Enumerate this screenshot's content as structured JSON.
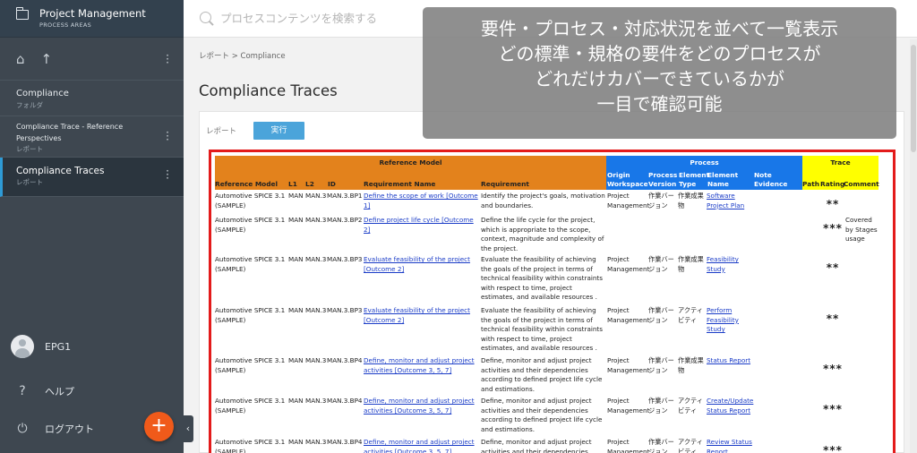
{
  "sidebar": {
    "header_title": "Project Management",
    "header_sub": "PROCESS AREAS",
    "items": [
      {
        "title": "Compliance",
        "sub": "フォルダ"
      },
      {
        "title": "Compliance Trace - Reference Perspectives",
        "sub": "レポート"
      },
      {
        "title": "Compliance Traces",
        "sub": "レポート"
      }
    ],
    "user": "EPG1",
    "help": "ヘルプ",
    "logout": "ログアウト",
    "fab": "+",
    "collapse": "‹",
    "home_icon": "⌂",
    "up_icon": "↑"
  },
  "search": {
    "placeholder": "プロセスコンテンツを検索する"
  },
  "breadcrumb": "レポート > Compliance",
  "page_title": "Compliance Traces",
  "report_label": "レポート",
  "run_button": "実行",
  "overlay": [
    "要件・プロセス・対応状況を並べて一覧表示",
    "どの標準・規格の要件をどのプロセスが",
    "どれだけカバーできているかが",
    "一目で確認可能"
  ],
  "table": {
    "group_headers": {
      "reference": "Reference Model",
      "process": "Process",
      "trace": "Trace"
    },
    "columns": {
      "ref_model": "Reference Model",
      "l1": "L1",
      "l2": "L2",
      "id": "ID",
      "req_name": "Requirement Name",
      "req": "Requirement",
      "origin": "Origin Workspace",
      "pver": "Process Version",
      "etype": "Element Type",
      "ename": "Element Name",
      "note": "Note Evidence",
      "path": "Path",
      "rating": "Rating",
      "comment": "Comment"
    },
    "rows": [
      {
        "ref": "Automotive SPICE 3.1 (SAMPLE)",
        "l1": "MAN",
        "l2": "MAN.3",
        "id": "MAN.3.BP1",
        "rname": "Define the scope of work [Outcome 1]",
        "req": "Identify the project's goals, motivation and boundaries.",
        "origin": "Project Management",
        "pver": "作業バージョン",
        "etype": "作業成果物",
        "ename": "Software Project Plan",
        "rating": "**",
        "comment": ""
      },
      {
        "ref": "Automotive SPICE 3.1 (SAMPLE)",
        "l1": "MAN",
        "l2": "MAN.3",
        "id": "MAN.3.BP2",
        "rname": "Define project life cycle [Outcome 2]",
        "req": "Define the life cycle for the project, which is appropriate to the scope, context, magnitude and complexity of the project.",
        "origin": "",
        "pver": "",
        "etype": "",
        "ename": "",
        "rating": "***",
        "comment": "Covered by Stages usage"
      },
      {
        "ref": "Automotive SPICE 3.1 (SAMPLE)",
        "l1": "MAN",
        "l2": "MAN.3",
        "id": "MAN.3.BP3",
        "rname": "Evaluate feasibility of the project [Outcome 2]",
        "req": "Evaluate the feasibility of achieving the goals of the project in terms of technical feasibility within constraints with respect to time, project estimates, and available resources .",
        "origin": "Project Management",
        "pver": "作業バージョン",
        "etype": "作業成果物",
        "ename": "Feasibility Study",
        "rating": "**",
        "comment": ""
      },
      {
        "ref": "Automotive SPICE 3.1 (SAMPLE)",
        "l1": "MAN",
        "l2": "MAN.3",
        "id": "MAN.3.BP3",
        "rname": "Evaluate feasibility of the project [Outcome 2]",
        "req": "Evaluate the feasibility of achieving the goals of the project in terms of technical feasibility within constraints with respect to time, project estimates, and available resources .",
        "origin": "Project Management",
        "pver": "作業バージョン",
        "etype": "アクティビティ",
        "ename": "Perform Feasibility Study",
        "rating": "**",
        "comment": ""
      },
      {
        "ref": "Automotive SPICE 3.1 (SAMPLE)",
        "l1": "MAN",
        "l2": "MAN.3",
        "id": "MAN.3.BP4",
        "rname": "Define, monitor and adjust project activities [Outcome 3, 5, 7]",
        "req": "Define, monitor and adjust project activities and their dependencies according to defined project life cycle and estimations.",
        "origin": "Project Management",
        "pver": "作業バージョン",
        "etype": "作業成果物",
        "ename": "Status Report",
        "rating": "***",
        "comment": ""
      },
      {
        "ref": "Automotive SPICE 3.1 (SAMPLE)",
        "l1": "MAN",
        "l2": "MAN.3",
        "id": "MAN.3.BP4",
        "rname": "Define, monitor and adjust project activities [Outcome 3, 5, 7]",
        "req": "Define, monitor and adjust project activities and their dependencies according to defined project life cycle and estimations.",
        "origin": "Project Management",
        "pver": "作業バージョン",
        "etype": "アクティビティ",
        "ename": "Create/Update Status Report",
        "rating": "***",
        "comment": ""
      },
      {
        "ref": "Automotive SPICE 3.1 (SAMPLE)",
        "l1": "MAN",
        "l2": "MAN.3",
        "id": "MAN.3.BP4",
        "rname": "Define, monitor and adjust project activities [Outcome 3, 5, 7]",
        "req": "Define, monitor and adjust project activities and their dependencies according to defined project life cycle and estimations.",
        "origin": "Project Management",
        "pver": "作業バージョン",
        "etype": "アクティビティ",
        "ename": "Review Status Report",
        "rating": "***",
        "comment": ""
      }
    ]
  }
}
